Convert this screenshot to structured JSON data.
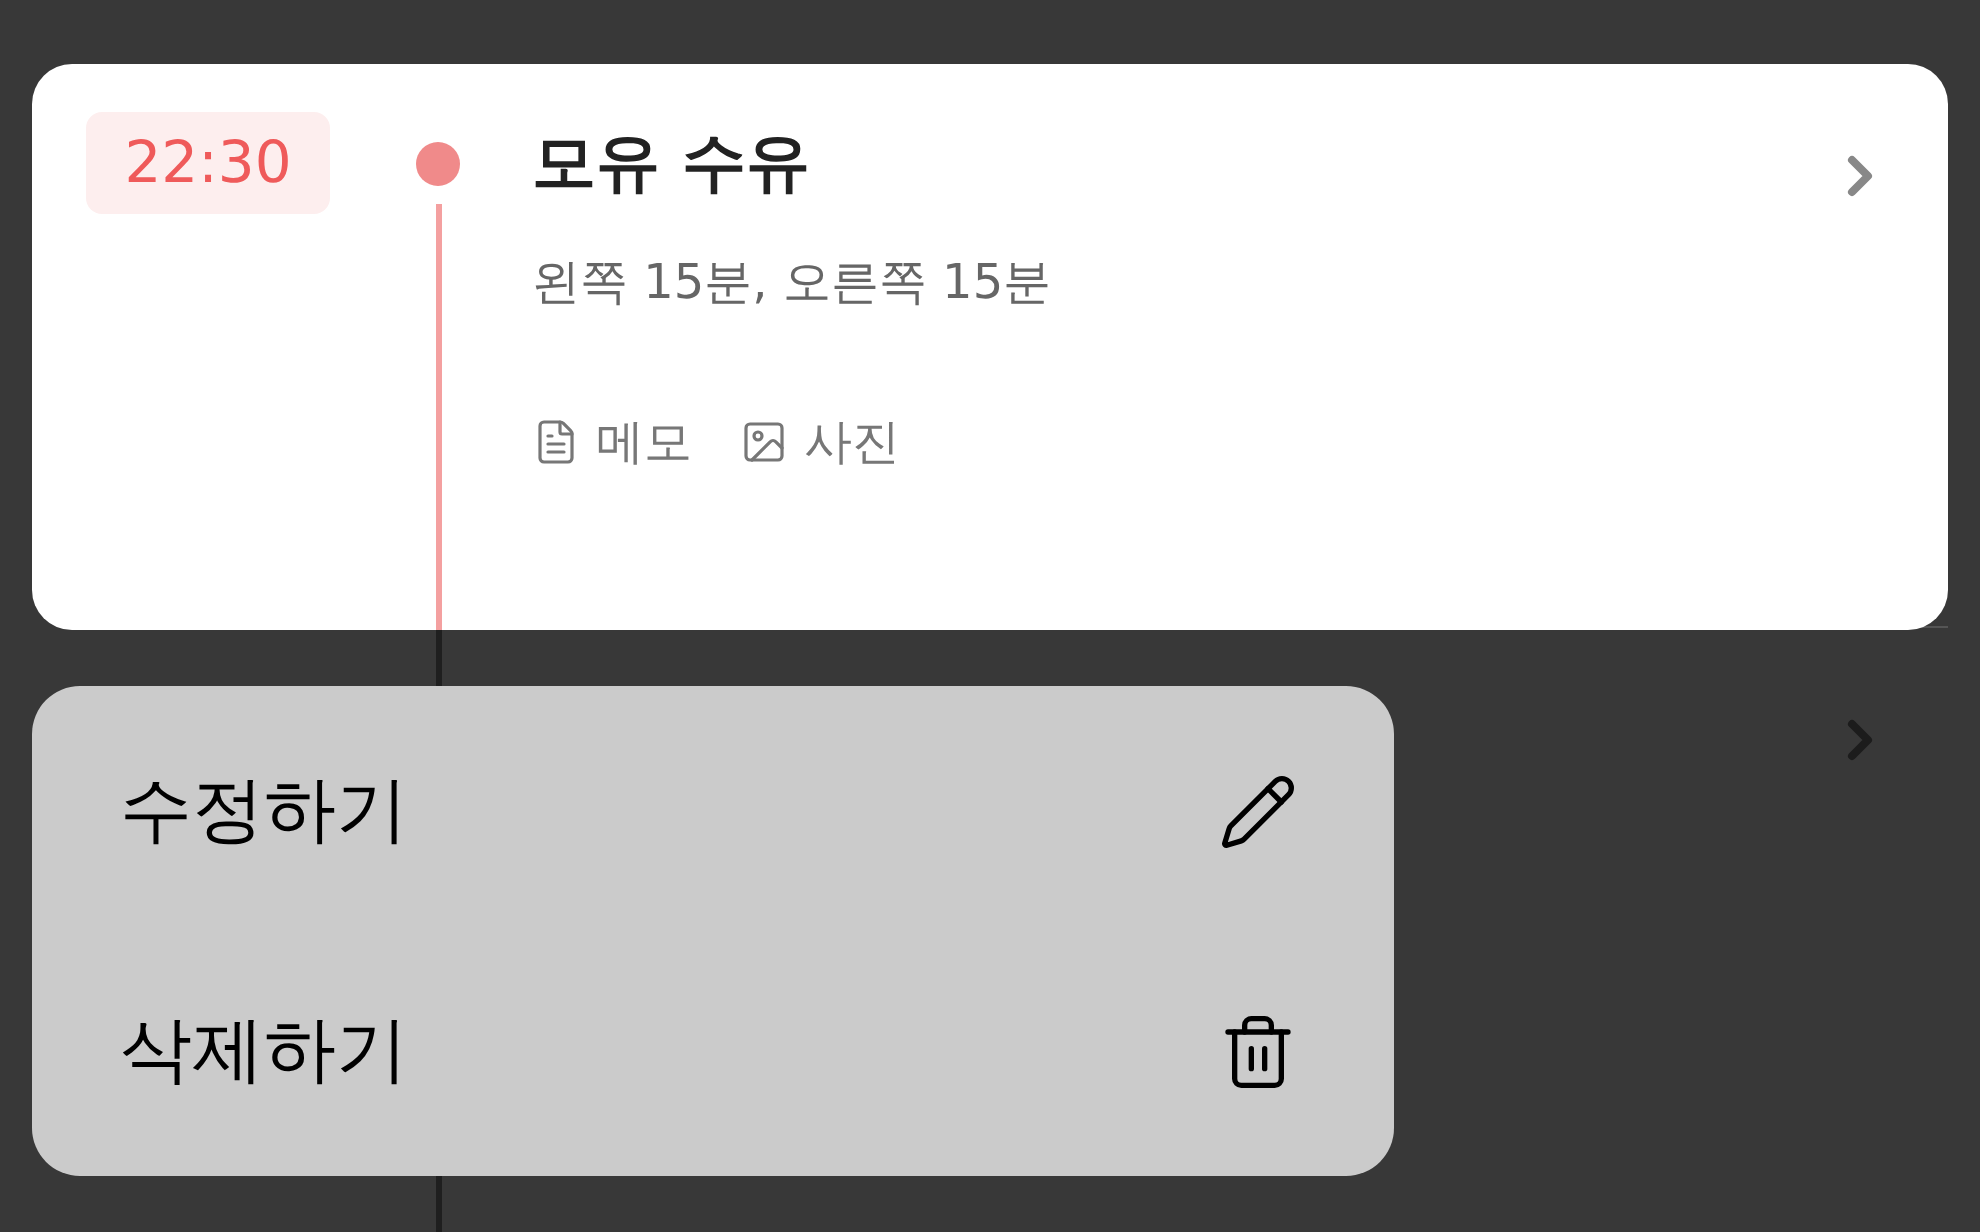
{
  "entry": {
    "time": "22:30",
    "title": "모유 수유",
    "detail": "왼쪽 15분, 오른쪽 15분",
    "attachments": [
      {
        "kind": "memo",
        "label": "메모"
      },
      {
        "kind": "photo",
        "label": "사진"
      }
    ]
  },
  "context_menu": [
    {
      "kind": "edit",
      "label": "수정하기"
    },
    {
      "kind": "delete",
      "label": "삭제하기"
    }
  ]
}
